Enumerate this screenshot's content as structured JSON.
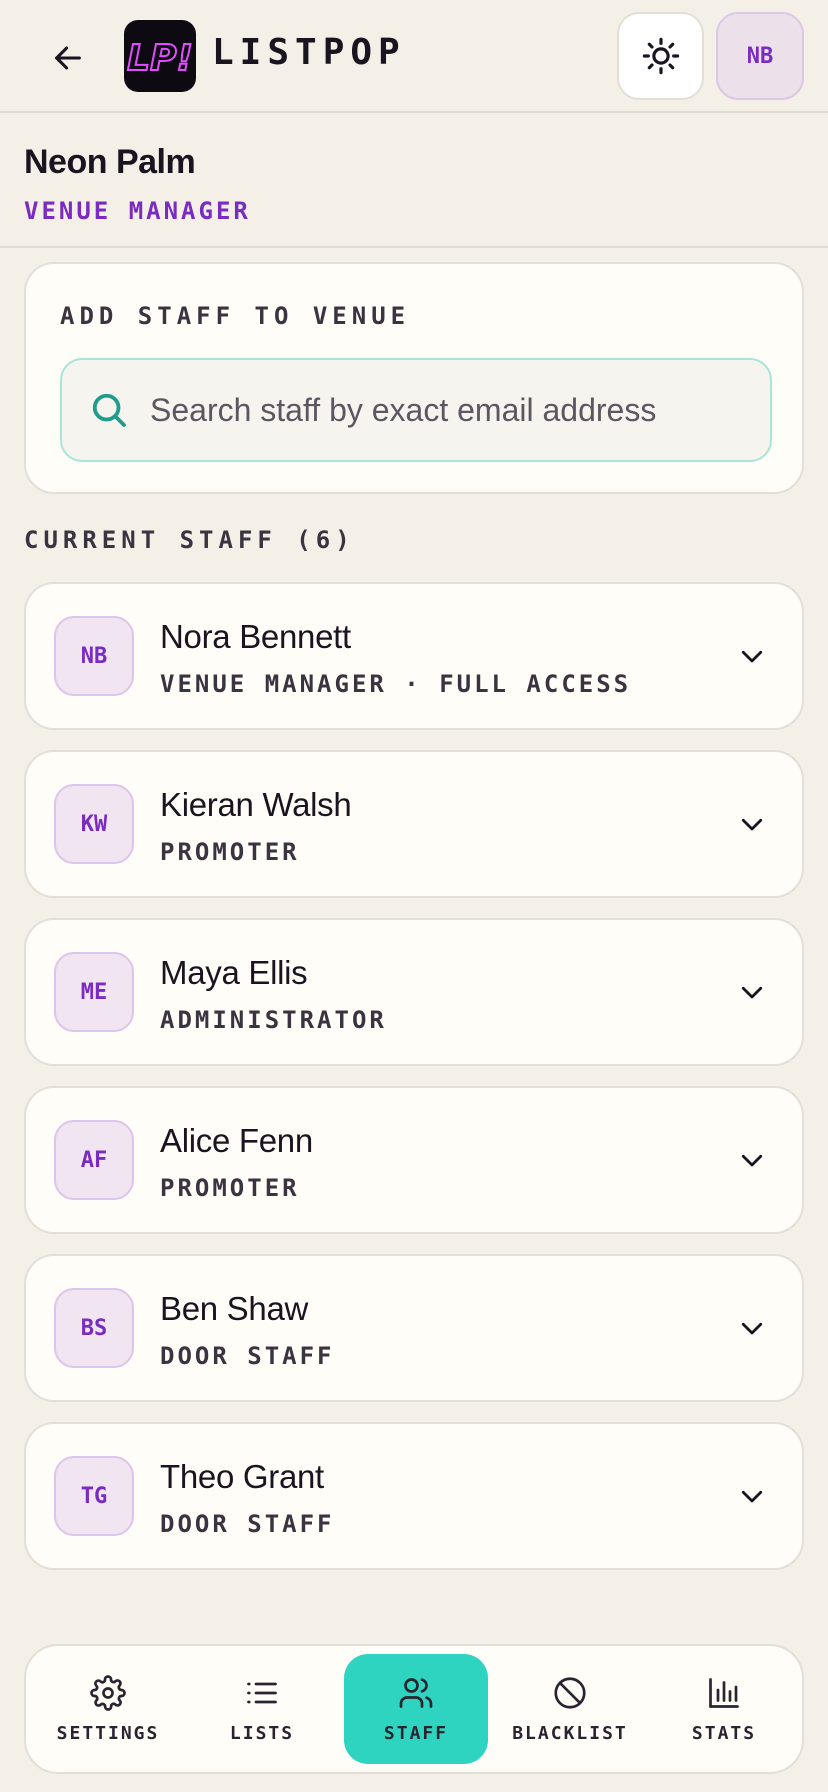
{
  "header": {
    "brand": "LISTPOP",
    "logo_text": "LP!",
    "user_initials": "NB"
  },
  "venue": {
    "name": "Neon Palm",
    "role": "VENUE MANAGER"
  },
  "add_staff": {
    "title": "ADD STAFF TO VENUE",
    "search_placeholder": "Search staff by exact email address"
  },
  "staff": {
    "heading": "CURRENT STAFF (6)",
    "members": [
      {
        "initials": "NB",
        "name": "Nora Bennett",
        "role": "VENUE MANAGER · FULL ACCESS"
      },
      {
        "initials": "KW",
        "name": "Kieran Walsh",
        "role": "PROMOTER"
      },
      {
        "initials": "ME",
        "name": "Maya Ellis",
        "role": "ADMINISTRATOR"
      },
      {
        "initials": "AF",
        "name": "Alice Fenn",
        "role": "PROMOTER"
      },
      {
        "initials": "BS",
        "name": "Ben Shaw",
        "role": "DOOR STAFF"
      },
      {
        "initials": "TG",
        "name": "Theo Grant",
        "role": "DOOR STAFF"
      }
    ]
  },
  "nav": {
    "items": [
      {
        "label": "SETTINGS",
        "icon": "gear-icon",
        "active": false
      },
      {
        "label": "LISTS",
        "icon": "list-icon",
        "active": false
      },
      {
        "label": "STAFF",
        "icon": "users-icon",
        "active": true
      },
      {
        "label": "BLACKLIST",
        "icon": "ban-icon",
        "active": false
      },
      {
        "label": "STATS",
        "icon": "bar-chart-icon",
        "active": false
      }
    ]
  },
  "colors": {
    "accent": "#2ed4c0",
    "brand_purple": "#7b2cc0",
    "background": "#f4f0e8"
  }
}
